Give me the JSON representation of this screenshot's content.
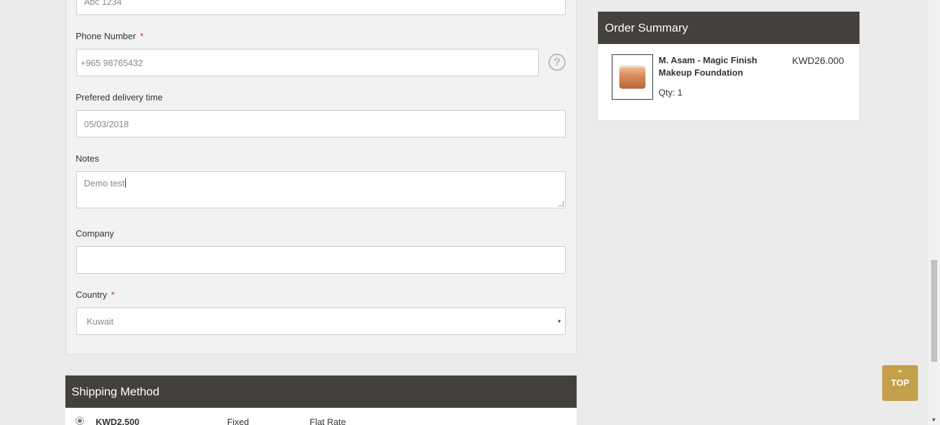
{
  "form": {
    "postal_value": "Abc 1234",
    "phone_label": "Phone Number",
    "required_mark": "*",
    "phone_value": "+965  98765432",
    "help_symbol": "?",
    "delivery_label": "Prefered delivery time",
    "delivery_value": "05/03/2018",
    "notes_label": "Notes",
    "notes_value": "Demo test",
    "company_label": "Company",
    "company_value": "",
    "country_label": "Country",
    "country_value": "Kuwait",
    "select_arrow": "▾"
  },
  "shipping": {
    "title": "Shipping Method",
    "option": {
      "price": "KWD2.500",
      "type": "Fixed",
      "name": "Flat Rate"
    }
  },
  "summary": {
    "title": "Order Summary",
    "item": {
      "name": "M. Asam - Magic Finish Makeup Foundation",
      "price": "KWD26.000",
      "qty": "Qty: 1",
      "image_icon": "product-jar-icon"
    }
  },
  "top_button": {
    "arrow": "⌃",
    "label": "TOP"
  },
  "scrollbar": {
    "down_arrow": "▼"
  },
  "colors": {
    "header_bg": "#44403c",
    "top_button_bg": "#c4a04a",
    "required": "#c0392b",
    "page_bg": "#ebebeb"
  }
}
